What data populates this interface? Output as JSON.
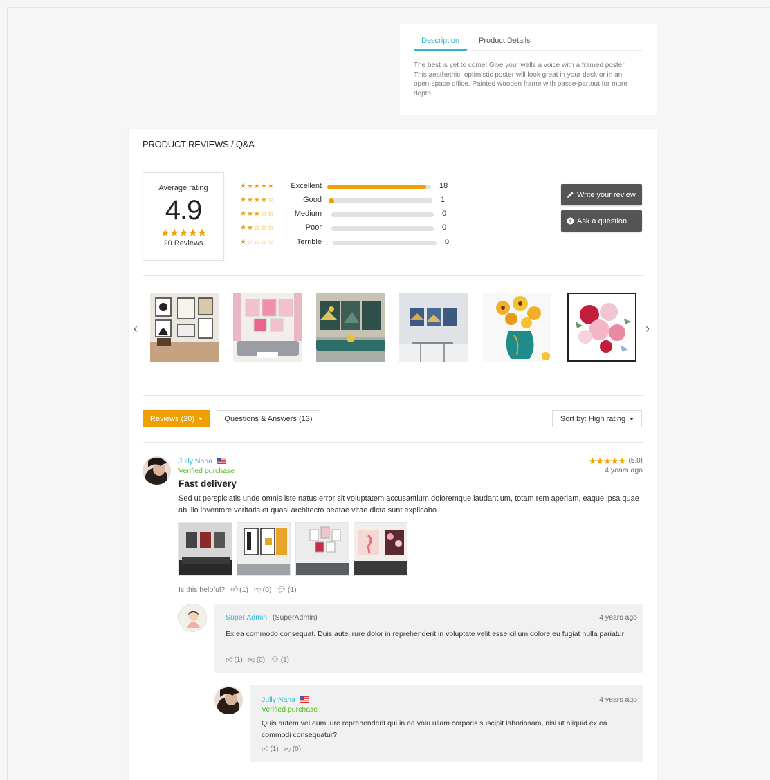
{
  "description": {
    "tabs": [
      "Description",
      "Product Details"
    ],
    "text": "The best is yet to come! Give your walls a voice with a framed poster. This aesthethic, optimistic poster will look great in your desk or in an open-space office. Painted wooden frame with passe-partout for more depth."
  },
  "reviews_panel": {
    "title": "PRODUCT REVIEWS / Q&A",
    "average": {
      "label": "Average rating",
      "value": "4.9",
      "stars": "★★★★★",
      "count_label": "20 Reviews"
    },
    "distribution": [
      {
        "stars": "★★★★★",
        "label": "Excellent",
        "count": "18",
        "fraction": 0.95
      },
      {
        "stars": "★★★★☆",
        "label": "Good",
        "count": "1",
        "fraction": 0.05
      },
      {
        "stars": "★★★☆☆",
        "label": "Medium",
        "count": "0",
        "fraction": 0
      },
      {
        "stars": "★★☆☆☆",
        "label": "Poor",
        "count": "0",
        "fraction": 0
      },
      {
        "stars": "★☆☆☆☆",
        "label": "Terrible",
        "count": "0",
        "fraction": 0
      }
    ],
    "buttons": {
      "write_review": "Write your review",
      "ask_question": "Ask a question"
    },
    "tabs": {
      "reviews": "Reviews (20)",
      "questions": "Questions & Answers (13)",
      "sort": "Sort by: High rating"
    }
  },
  "review": {
    "author": "Jully Nana",
    "verified": "Verified purchase",
    "rating_stars": "★★★★★",
    "rating_score": "(5.0)",
    "time": "4 years ago",
    "title": "Fast delivery",
    "body": "Sed ut perspiciatis unde omnis iste natus error sit voluptatem accusantium doloremque laudantium, totam rem aperiam, eaque ipsa quae ab illo inventore veritatis et quasi architecto beatae vitae dicta sunt explicabo",
    "helpful_label": "Is this helpful?",
    "likes": "(1)",
    "dislikes": "(0)",
    "comments": "(1)"
  },
  "reply1": {
    "author": "Super Admin",
    "role": "(SuperAdmin)",
    "time": "4 years ago",
    "text": "Ex ea commodo consequat. Duis aute irure dolor in reprehenderit in voluptate velit esse cillum dolore eu fugiat nulla pariatur",
    "likes": "(1)",
    "dislikes": "(0)",
    "comments": "(1)"
  },
  "reply2": {
    "author": "Jully Nana",
    "verified": "Verified purchase",
    "time": "4 years ago",
    "text": "Quis autem vel eum iure reprehenderit qui in ea volu ullam corporis suscipit laboriosam, nisi ut aliquid ex ea commodi consequatur?",
    "likes": "(1)",
    "dislikes": "(0)"
  },
  "colors": {
    "accent": "#f0a000",
    "link": "#2fb5d2",
    "verified": "#4cbb17",
    "dark_button": "#555555"
  }
}
